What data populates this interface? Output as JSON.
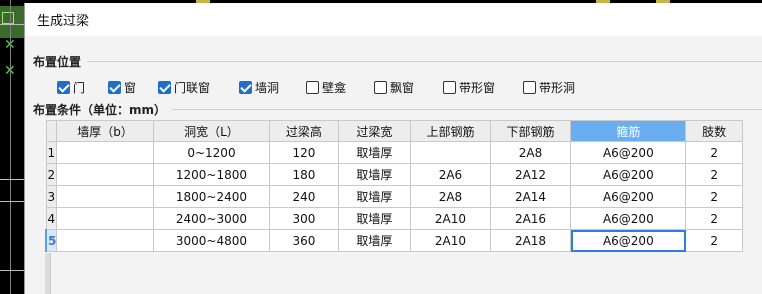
{
  "dialog": {
    "title": "生成过梁"
  },
  "placement": {
    "group_title": "布置位置",
    "options": [
      {
        "label": "门",
        "checked": true
      },
      {
        "label": "窗",
        "checked": true
      },
      {
        "label": "门联窗",
        "checked": true
      },
      {
        "label": "墙洞",
        "checked": true
      },
      {
        "label": "壁龛",
        "checked": false
      },
      {
        "label": "飘窗",
        "checked": false
      },
      {
        "label": "带形窗",
        "checked": false
      },
      {
        "label": "带形洞",
        "checked": false
      }
    ]
  },
  "conditions": {
    "group_title": "布置条件（单位：mm）",
    "columns": [
      "墙厚（b）",
      "洞宽（L）",
      "过梁高",
      "过梁宽",
      "上部钢筋",
      "下部钢筋",
      "箍筋",
      "肢数"
    ],
    "rows": [
      {
        "n": "1",
        "cells": [
          "",
          "0~1200",
          "120",
          "取墙厚",
          "",
          "2A8",
          "A6@200",
          "2"
        ]
      },
      {
        "n": "2",
        "cells": [
          "",
          "1200~1800",
          "180",
          "取墙厚",
          "2A6",
          "2A12",
          "A6@200",
          "2"
        ]
      },
      {
        "n": "3",
        "cells": [
          "",
          "1800~2400",
          "240",
          "取墙厚",
          "2A8",
          "2A14",
          "A6@200",
          "2"
        ]
      },
      {
        "n": "4",
        "cells": [
          "",
          "2400~3000",
          "300",
          "取墙厚",
          "2A10",
          "2A16",
          "A6@200",
          "2"
        ]
      },
      {
        "n": "5",
        "cells": [
          "",
          "3000~4800",
          "360",
          "取墙厚",
          "2A10",
          "2A18",
          "A6@200",
          "2"
        ]
      }
    ],
    "highlighted_column": "箍筋",
    "current_row": "5"
  },
  "colors": {
    "accent": "#1f6ec9",
    "header_highlight": "#6aaef0"
  }
}
